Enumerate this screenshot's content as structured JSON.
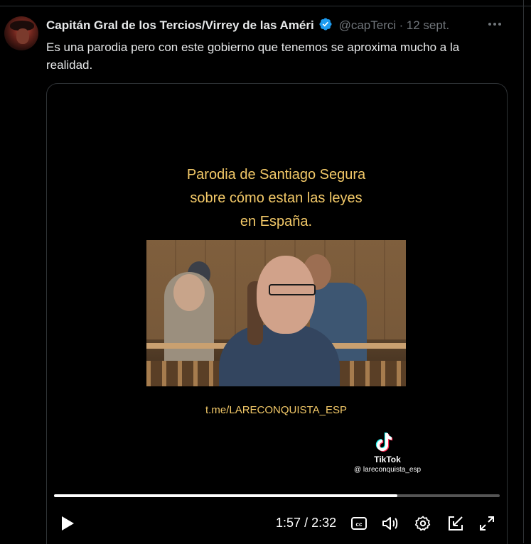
{
  "tweet": {
    "author_name": "Capitán Gral de los Tercios/Virrey de las Améri",
    "handle": "@capTerci",
    "separator": "·",
    "date": "12 sept.",
    "text": "Es una parodia pero con este gobierno que tenemos se aproxima mucho a la realidad."
  },
  "video": {
    "title_line1": "Parodia de Santiago Segura",
    "title_line2": "sobre cómo estan las leyes",
    "title_line3": "en España.",
    "link": "t.me/LARECONQUISTA_ESP",
    "tiktok_label": "TikTok",
    "tiktok_user": "@ lareconquista_esp",
    "current_time": "1:57",
    "duration": "2:32",
    "time_separator": "/",
    "progress_fraction": 0.77
  },
  "colors": {
    "background": "#000000",
    "text": "#e7e9ea",
    "secondary": "#71767b",
    "verified": "#1d9bf0",
    "overlay_text": "#f3c968"
  },
  "icons": {
    "verified": "verified-badge-icon",
    "more": "more-options-icon",
    "play": "play-icon",
    "captions": "captions-icon",
    "volume": "volume-icon",
    "settings": "gear-icon",
    "pip": "picture-in-picture-icon",
    "fullscreen": "fullscreen-icon"
  }
}
